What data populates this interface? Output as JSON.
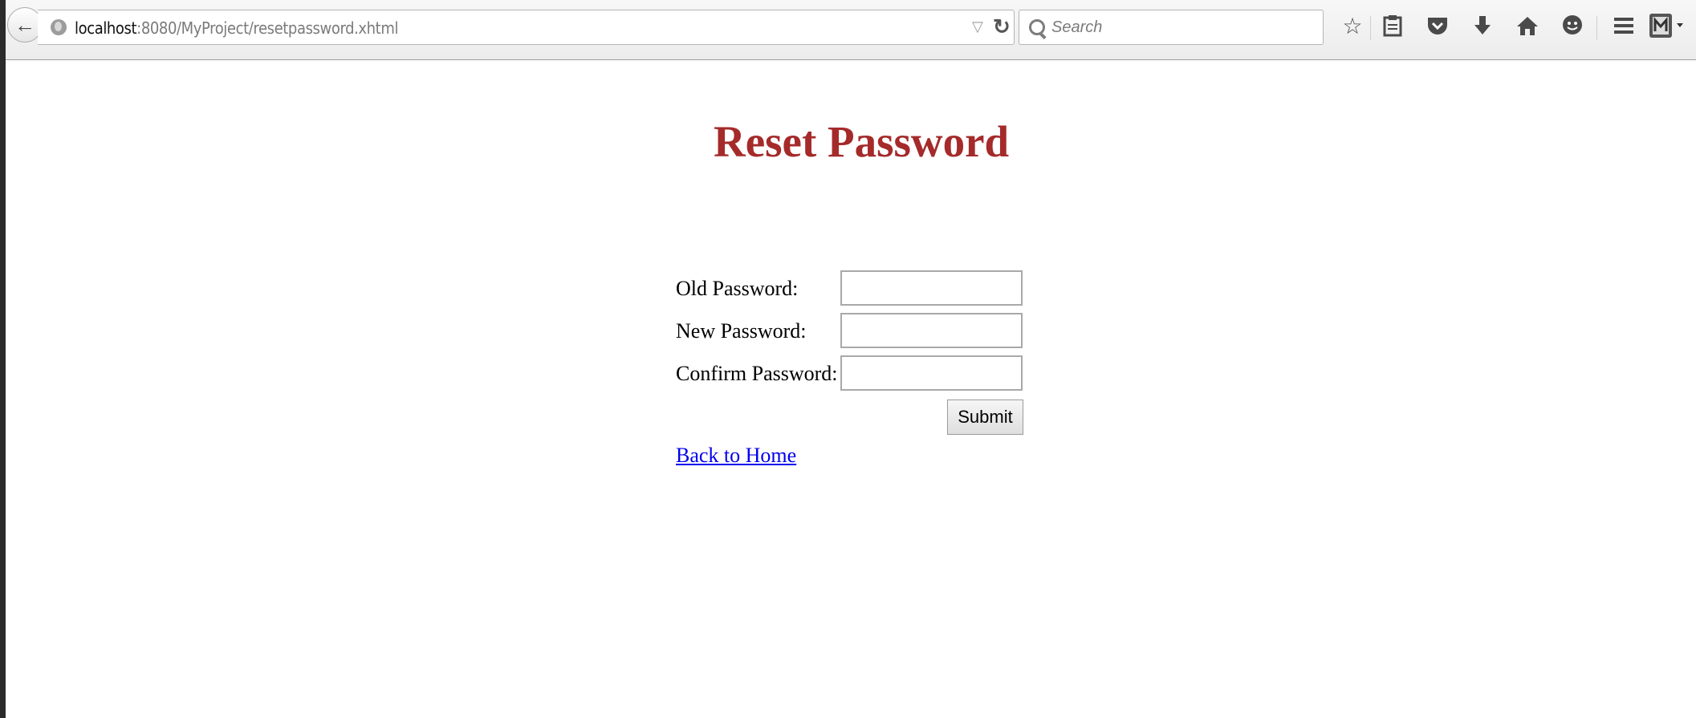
{
  "browser": {
    "url_host": "localhost",
    "url_rest": ":8080/MyProject/resetpassword.xhtml",
    "search_placeholder": "Search",
    "icons": [
      "back-arrow-icon",
      "globe-icon",
      "dropdown-icon",
      "reload-icon",
      "search-icon",
      "bookmark-star-icon",
      "reading-list-icon",
      "pocket-icon",
      "download-icon",
      "home-icon",
      "chat-icon",
      "menu-icon",
      "extension-icon"
    ]
  },
  "page": {
    "title": "Reset Password",
    "title_color": "#a52a2a",
    "form": {
      "old_password_label": "Old Password:",
      "new_password_label": "New Password:",
      "confirm_password_label": "Confirm Password:",
      "old_password_value": "",
      "new_password_value": "",
      "confirm_password_value": "",
      "submit_label": "Submit"
    },
    "back_link": "Back to Home",
    "link_color": "#0000ee"
  }
}
